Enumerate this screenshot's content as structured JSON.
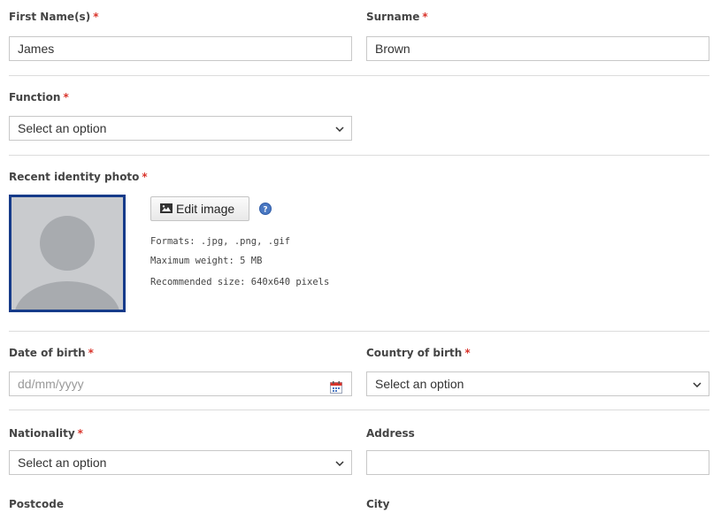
{
  "form": {
    "first_name": {
      "label": "First Name(s)",
      "required": "*",
      "value": "James"
    },
    "surname": {
      "label": "Surname",
      "required": "*",
      "value": "Brown"
    },
    "function": {
      "label": "Function",
      "required": "*",
      "selected": "Select an option"
    },
    "photo": {
      "label": "Recent identity photo",
      "required": "*",
      "edit_button": "Edit image",
      "formats": "Formats: .jpg, .png, .gif",
      "max_weight": "Maximum weight: 5 MB",
      "recommended_size": "Recommended size: 640x640 pixels"
    },
    "date_of_birth": {
      "label": "Date of birth",
      "required": "*",
      "placeholder": "dd/mm/yyyy"
    },
    "country_of_birth": {
      "label": "Country of birth",
      "required": "*",
      "selected": "Select an option"
    },
    "nationality": {
      "label": "Nationality",
      "required": "*",
      "selected": "Select an option"
    },
    "address": {
      "label": "Address",
      "value": ""
    },
    "postcode": {
      "label": "Postcode"
    },
    "city": {
      "label": "City"
    }
  },
  "colors": {
    "required_marker": "#d9342b",
    "photo_border": "#163b8a",
    "field_border": "#c8c8c8",
    "help_icon": "#4a78c2"
  }
}
